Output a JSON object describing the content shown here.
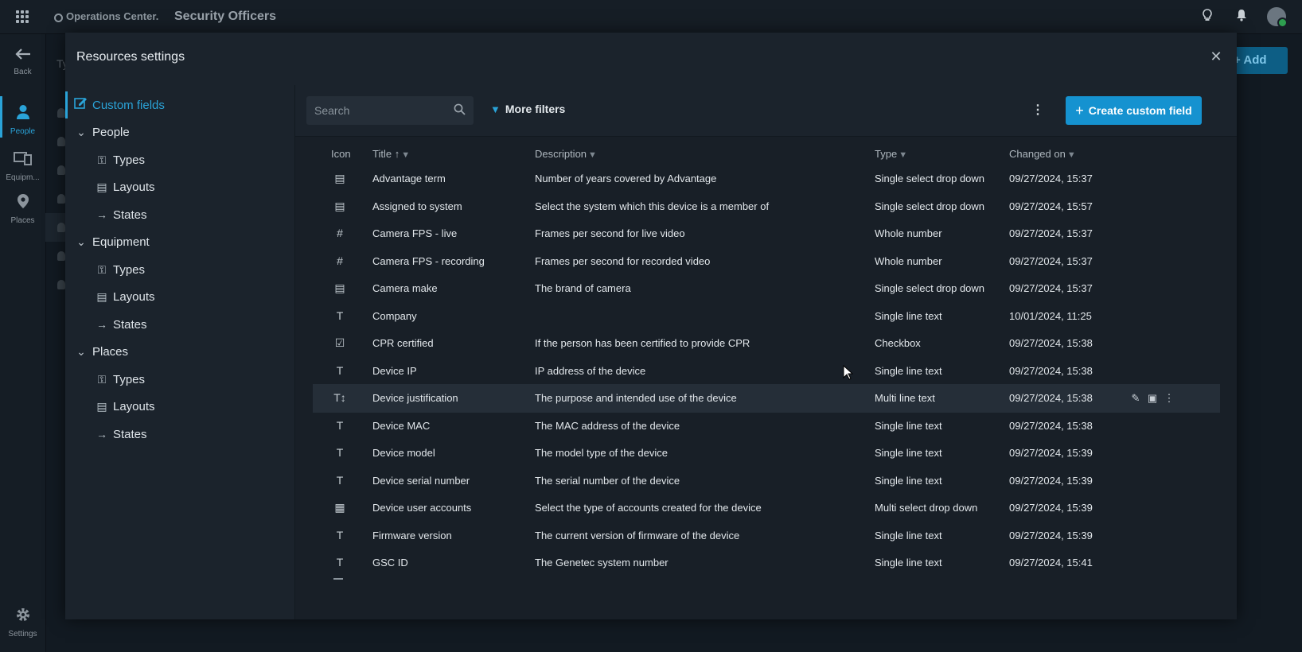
{
  "app": {
    "brand": "Operations Center.",
    "page_title": "Security Officers"
  },
  "leftnav": [
    {
      "label": "Back",
      "icon": "back-arrow-icon"
    },
    {
      "label": "People",
      "icon": "person-icon"
    },
    {
      "label": "Equipm...",
      "icon": "devices-icon"
    },
    {
      "label": "Places",
      "icon": "map-pin-icon"
    },
    {
      "label": "Settings",
      "icon": "gear-icon"
    }
  ],
  "background": {
    "button_label": "+ Add person",
    "column_text": "Ty"
  },
  "modal": {
    "title": "Resources settings"
  },
  "tree": {
    "custom_fields": "Custom fields",
    "groups": [
      {
        "label": "People",
        "children": [
          "Types",
          "Layouts",
          "States"
        ]
      },
      {
        "label": "Equipment",
        "children": [
          "Types",
          "Layouts",
          "States"
        ]
      },
      {
        "label": "Places",
        "children": [
          "Types",
          "Layouts",
          "States"
        ]
      }
    ]
  },
  "toolbar": {
    "search_placeholder": "Search",
    "more_filters": "More filters",
    "create_label": "Create custom field"
  },
  "table": {
    "headers": {
      "icon": "Icon",
      "title": "Title",
      "description": "Description",
      "type": "Type",
      "changed_on": "Changed on"
    },
    "rows": [
      {
        "icon": "▤",
        "title": "Advantage term",
        "description": "Number of years covered by Advantage",
        "type": "Single select drop down",
        "changed": "09/27/2024, 15:37"
      },
      {
        "icon": "▤",
        "title": "Assigned to system",
        "description": "Select the system which this device is a member of",
        "type": "Single select drop down",
        "changed": "09/27/2024, 15:57"
      },
      {
        "icon": "#",
        "title": "Camera FPS - live",
        "description": "Frames per second for live video",
        "type": "Whole number",
        "changed": "09/27/2024, 15:37"
      },
      {
        "icon": "#",
        "title": "Camera FPS - recording",
        "description": "Frames per second for recorded video",
        "type": "Whole number",
        "changed": "09/27/2024, 15:37"
      },
      {
        "icon": "▤",
        "title": "Camera make",
        "description": "The brand of camera",
        "type": "Single select drop down",
        "changed": "09/27/2024, 15:37"
      },
      {
        "icon": "T",
        "title": "Company",
        "description": "",
        "type": "Single line text",
        "changed": "10/01/2024, 11:25"
      },
      {
        "icon": "☑",
        "title": "CPR certified",
        "description": "If the person has been certified to provide CPR",
        "type": "Checkbox",
        "changed": "09/27/2024, 15:38"
      },
      {
        "icon": "T",
        "title": "Device IP",
        "description": "IP address of the device",
        "type": "Single line text",
        "changed": "09/27/2024, 15:38"
      },
      {
        "icon": "T↕",
        "title": "Device justification",
        "description": "The purpose and intended use of the device",
        "type": "Multi line text",
        "changed": "09/27/2024, 15:38"
      },
      {
        "icon": "T",
        "title": "Device MAC",
        "description": "The MAC address of the device",
        "type": "Single line text",
        "changed": "09/27/2024, 15:38"
      },
      {
        "icon": "T",
        "title": "Device model",
        "description": "The model type of the device",
        "type": "Single line text",
        "changed": "09/27/2024, 15:39"
      },
      {
        "icon": "T",
        "title": "Device serial number",
        "description": "The serial number of the device",
        "type": "Single line text",
        "changed": "09/27/2024, 15:39"
      },
      {
        "icon": "▦",
        "title": "Device user accounts",
        "description": "Select the type of accounts created for the device",
        "type": "Multi select drop down",
        "changed": "09/27/2024, 15:39"
      },
      {
        "icon": "T",
        "title": "Firmware version",
        "description": "The current version of firmware of the device",
        "type": "Single line text",
        "changed": "09/27/2024, 15:39"
      },
      {
        "icon": "T",
        "title": "GSC ID",
        "description": "The Genetec system number",
        "type": "Single line text",
        "changed": "09/27/2024, 15:41"
      }
    ]
  },
  "colors": {
    "accent": "#1592d0",
    "selected": "#2aa3d8",
    "background": "#121a22",
    "modal": "#1b232c"
  }
}
